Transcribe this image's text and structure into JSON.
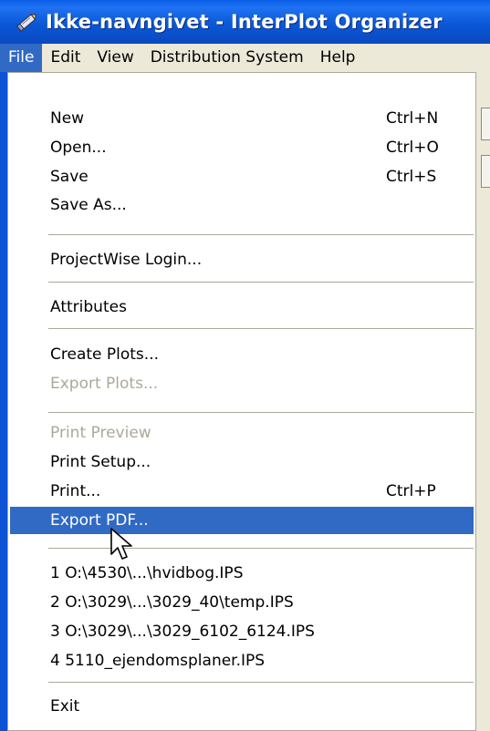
{
  "window": {
    "title": "Ikke-navngivet - InterPlot Organizer"
  },
  "menubar": {
    "items": [
      {
        "label": "File",
        "active": true
      },
      {
        "label": "Edit"
      },
      {
        "label": "View"
      },
      {
        "label": "Distribution System"
      },
      {
        "label": "Help"
      }
    ]
  },
  "file_menu": {
    "new": {
      "label": "New",
      "shortcut": "Ctrl+N"
    },
    "open": {
      "label": "Open...",
      "shortcut": "Ctrl+O"
    },
    "save": {
      "label": "Save",
      "shortcut": "Ctrl+S"
    },
    "save_as": {
      "label": "Save As..."
    },
    "projectwise_login": {
      "label": "ProjectWise Login..."
    },
    "attributes": {
      "label": "Attributes"
    },
    "create_plots": {
      "label": "Create Plots..."
    },
    "export_plots": {
      "label": "Export Plots...",
      "disabled": true
    },
    "print_preview": {
      "label": "Print Preview",
      "disabled": true
    },
    "print_setup": {
      "label": "Print Setup..."
    },
    "print": {
      "label": "Print...",
      "shortcut": "Ctrl+P"
    },
    "export_pdf": {
      "label": "Export PDF...",
      "highlighted": true
    },
    "recent_files": [
      "1 O:\\4530\\...\\hvidbog.IPS",
      "2 O:\\3029\\...\\3029_40\\temp.IPS",
      "3 O:\\3029\\...\\3029_6102_6124.IPS",
      "4 5110_ejendomsplaner.IPS"
    ],
    "exit": {
      "label": "Exit"
    }
  },
  "colors": {
    "highlight": "#316ac5",
    "disabled_text": "#aca899",
    "titlebar": "#0a58d8"
  },
  "icons": {
    "app": "pencil-ruler-icon",
    "cursor": "mouse-pointer-icon"
  }
}
